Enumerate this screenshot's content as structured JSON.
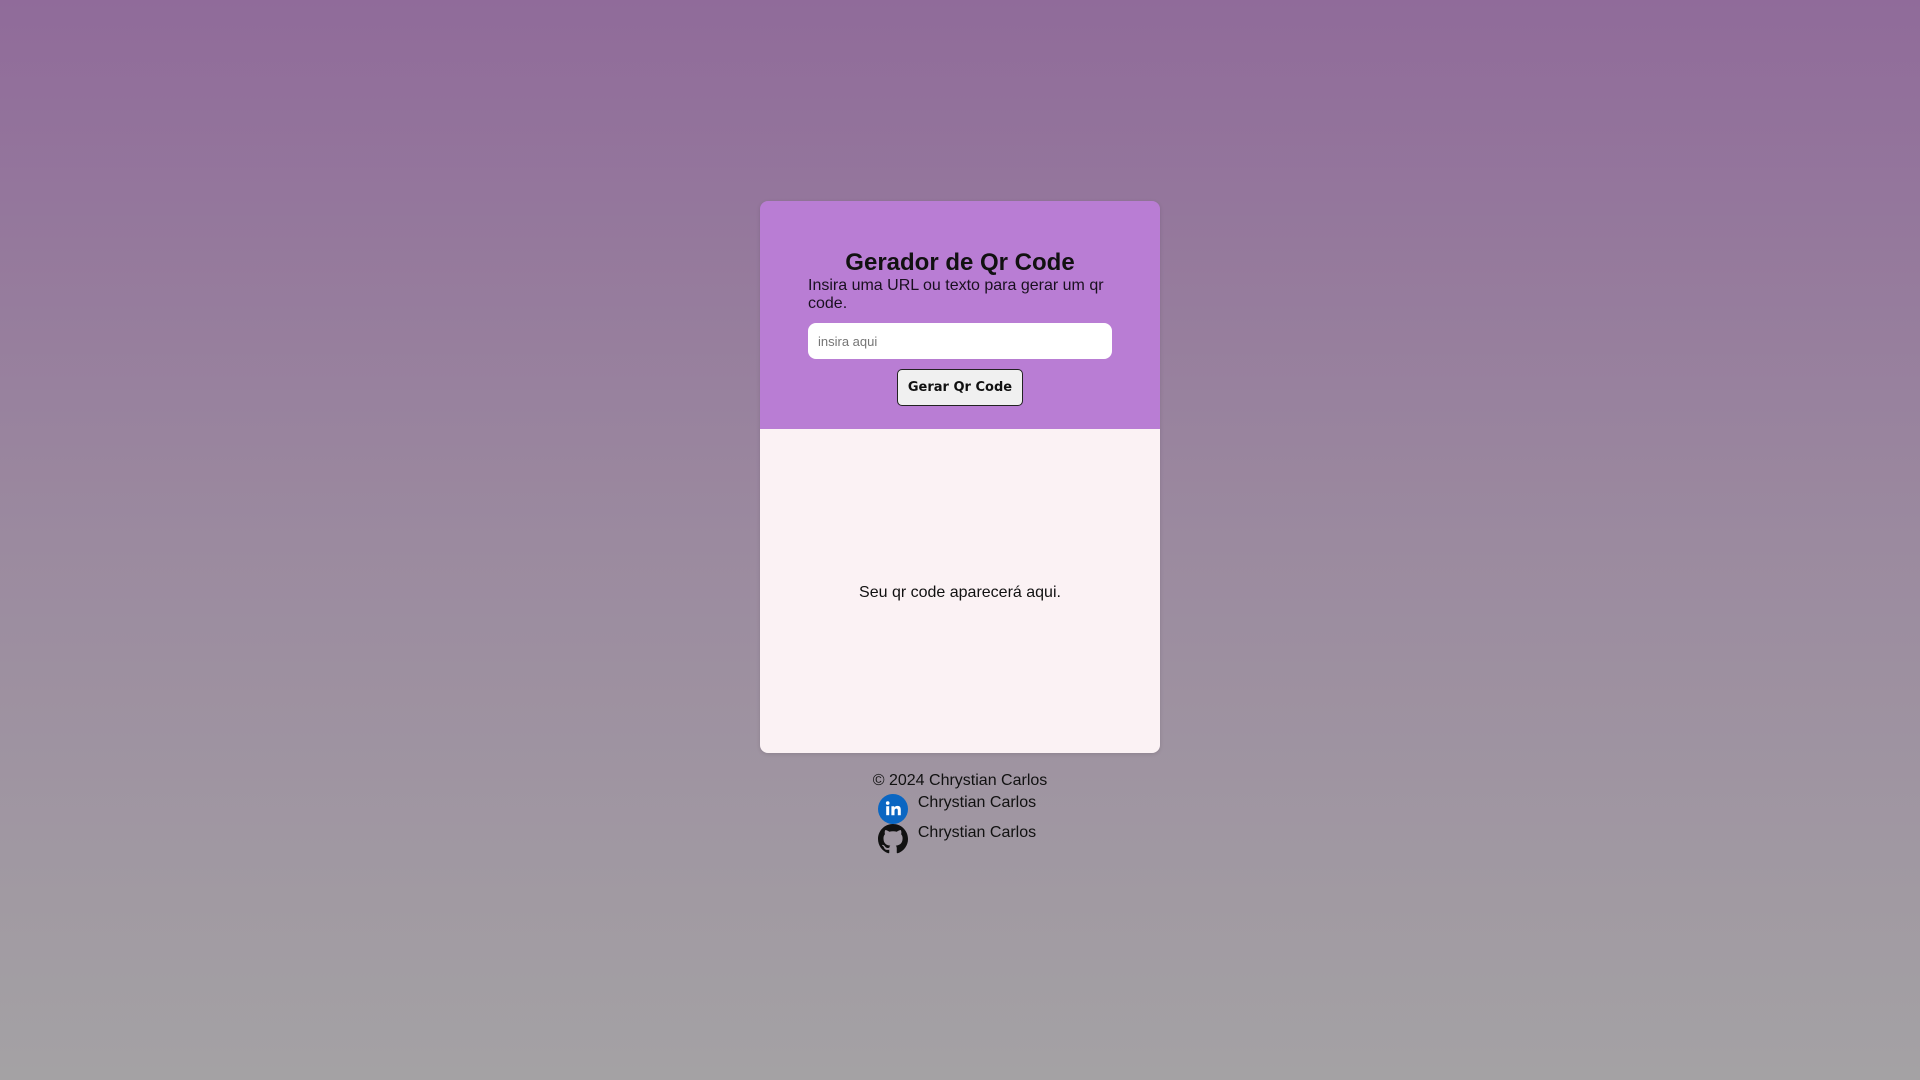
{
  "card": {
    "title": "Gerador de Qr Code",
    "subtitle": "Insira uma URL ou texto para gerar um qr code.",
    "input_placeholder": "insira aqui",
    "input_value": "",
    "button_label": "Gerar Qr Code",
    "result_placeholder": "Seu qr code aparecerá aqui."
  },
  "footer": {
    "copyright": "© 2024 Chrystian Carlos",
    "links": [
      {
        "icon": "linkedin-icon",
        "label": "Chrystian Carlos"
      },
      {
        "icon": "github-icon",
        "label": "Chrystian Carlos"
      }
    ]
  },
  "colors": {
    "card_header": "#b97dd4",
    "card_body": "#fbf2f4",
    "linkedin": "#0a66c2",
    "background_top": "#906b9a",
    "background_bottom": "#a4a2a4"
  }
}
